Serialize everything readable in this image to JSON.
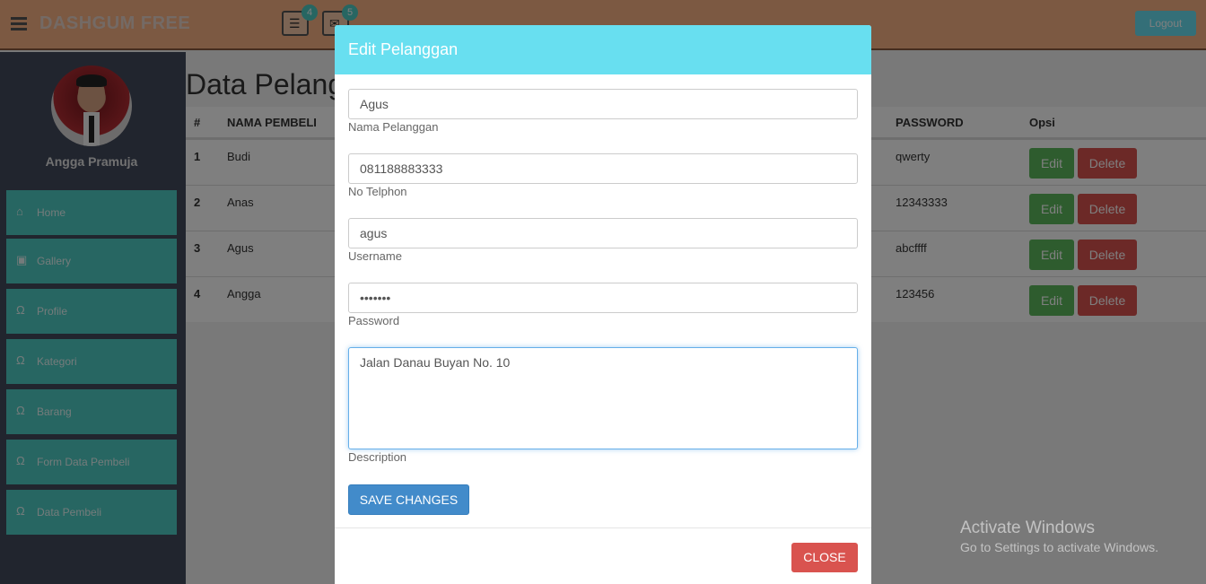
{
  "header": {
    "brand": "DASHGUM FREE",
    "notifications": [
      {
        "icon": "tasks-icon",
        "count": "4"
      },
      {
        "icon": "envelope-icon",
        "count": "5"
      }
    ],
    "logout_label": "Logout"
  },
  "sidebar": {
    "user_name": "Angga Pramuja",
    "items": [
      {
        "label": "Home",
        "icon": "home-icon"
      },
      {
        "label": "Gallery",
        "icon": "camera-icon"
      },
      {
        "label": "Profile",
        "icon": "user-icon"
      },
      {
        "label": "Kategori",
        "icon": "user-icon"
      },
      {
        "label": "Barang",
        "icon": "user-icon"
      },
      {
        "label": "Form Data Pembeli",
        "icon": "user-icon"
      },
      {
        "label": "Data Pembeli",
        "icon": "user-icon"
      }
    ]
  },
  "main": {
    "title": "Data Pelanggan",
    "columns": [
      "#",
      "NAMA PEMBELI",
      "PASSWORD",
      "Opsi"
    ],
    "rows": [
      {
        "no": "1",
        "name": "Budi",
        "password": "qwerty"
      },
      {
        "no": "2",
        "name": "Anas",
        "password": "12343333"
      },
      {
        "no": "3",
        "name": "Agus",
        "password": "abcffff"
      },
      {
        "no": "4",
        "name": "Angga",
        "password": "123456"
      }
    ],
    "edit_label": "Edit",
    "delete_label": "Delete"
  },
  "modal": {
    "title": "Edit Pelanggan",
    "fields": {
      "nama": {
        "value": "Agus",
        "label": "Nama Pelanggan"
      },
      "telp": {
        "value": "081188883333",
        "label": "No Telphon"
      },
      "username": {
        "value": "agus",
        "label": "Username"
      },
      "password": {
        "value": "•••••••",
        "label": "Password"
      },
      "description": {
        "value": "Jalan Danau Buyan No. 10",
        "label": "Description"
      }
    },
    "save_label": "SAVE CHANGES",
    "close_label": "CLOSE"
  },
  "watermark": {
    "line1": "Activate Windows",
    "line2": "Go to Settings to activate Windows."
  }
}
